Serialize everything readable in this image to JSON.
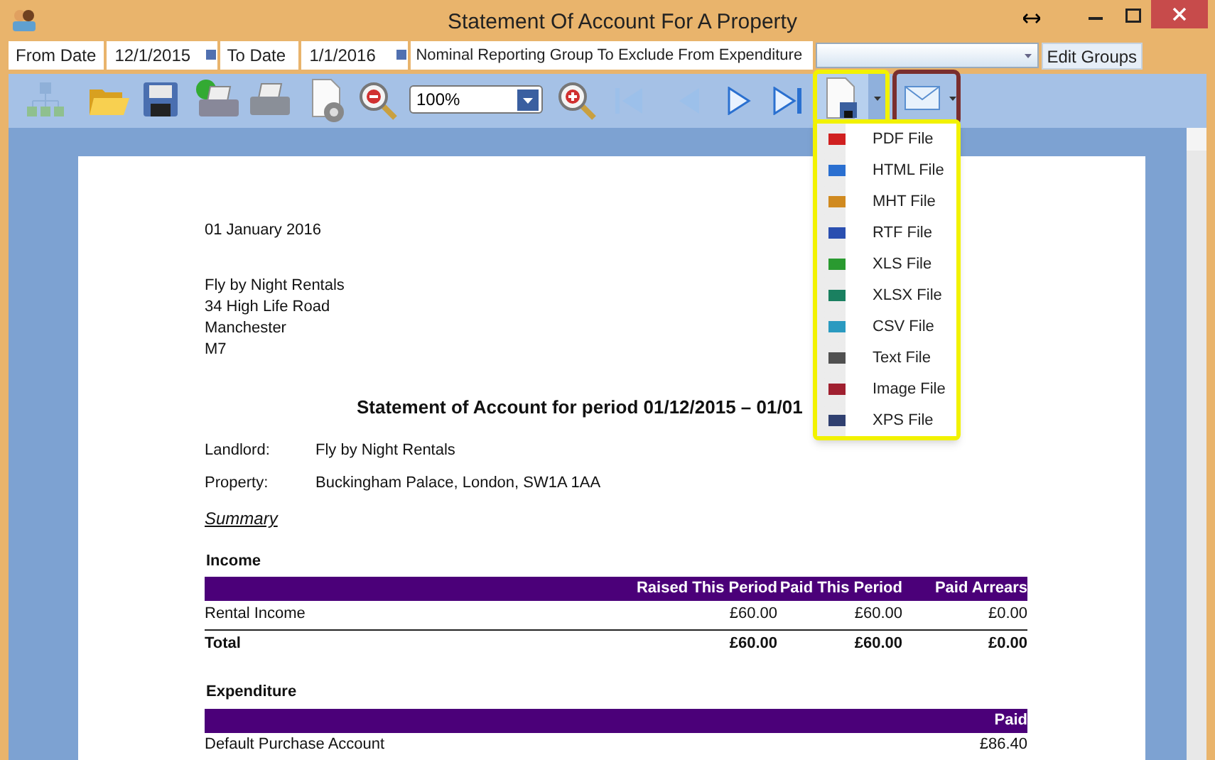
{
  "window": {
    "title": "Statement Of Account For A Property"
  },
  "parameters": {
    "from_label": "From Date",
    "from_value": "12/1/2015",
    "to_label": "To Date",
    "to_value": "1/1/2016",
    "group_label": "Nominal Reporting Group To Exclude From Expenditure",
    "edit_button": "Edit Groups"
  },
  "toolbar": {
    "zoom": "100%"
  },
  "export_menu": {
    "expanded": true,
    "items": [
      {
        "label": "PDF File",
        "color": "#d02020"
      },
      {
        "label": "HTML File",
        "color": "#2a6fd0"
      },
      {
        "label": "MHT File",
        "color": "#d08a20"
      },
      {
        "label": "RTF File",
        "color": "#2a4fb0"
      },
      {
        "label": "XLS File",
        "color": "#2a9a30"
      },
      {
        "label": "XLSX File",
        "color": "#1a8060"
      },
      {
        "label": "CSV File",
        "color": "#2a9ac0"
      },
      {
        "label": "Text File",
        "color": "#505050"
      },
      {
        "label": "Image File",
        "color": "#a02030"
      },
      {
        "label": "XPS File",
        "color": "#304070"
      }
    ]
  },
  "document": {
    "date": "01 January 2016",
    "address": [
      "Fly by Night Rentals",
      "34 High Life Road",
      "Manchester",
      "M7"
    ],
    "heading": "Statement of Account for period 01/12/2015 – 01/01",
    "details": [
      {
        "label": "Landlord:",
        "value": "Fly by Night Rentals"
      },
      {
        "label": "Property:",
        "value": "Buckingham Palace, London, SW1A 1AA"
      }
    ],
    "summary": "Summary",
    "income": {
      "title": "Income",
      "columns": [
        "Raised This Period",
        "Paid This Period",
        "Paid Arrears"
      ],
      "rows": [
        {
          "name": "Rental Income",
          "values": [
            "£60.00",
            "£60.00",
            "£0.00"
          ]
        }
      ],
      "total": {
        "name": "Total",
        "values": [
          "£60.00",
          "£60.00",
          "£0.00"
        ]
      }
    },
    "expenditure": {
      "title": "Expenditure",
      "columns": [
        "Paid"
      ],
      "rows": [
        {
          "name": "Default Purchase Account",
          "values": [
            "£86.40"
          ]
        }
      ]
    }
  }
}
